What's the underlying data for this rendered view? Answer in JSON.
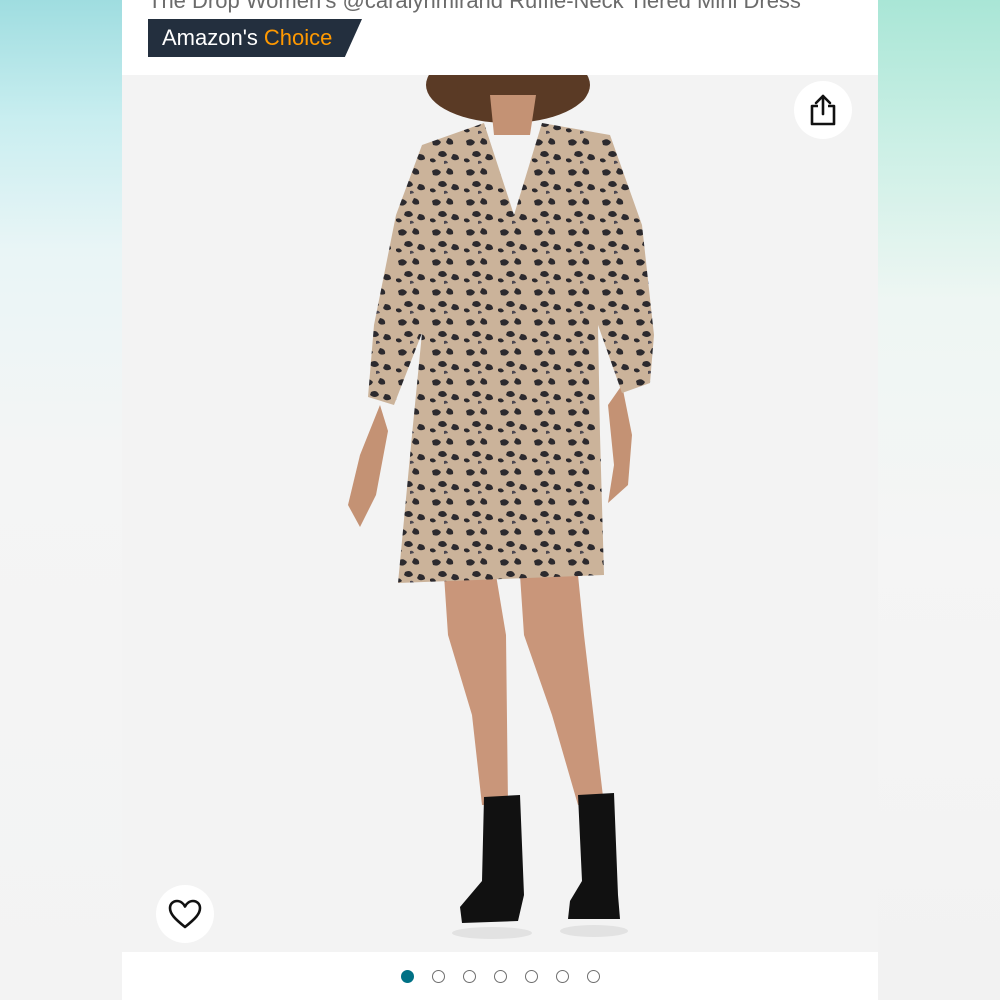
{
  "product": {
    "title": "The Drop Women's @caralynmirand Ruffle-Neck Tiered Mini Dress"
  },
  "badge": {
    "prefix": "Amazon's",
    "accent": "Choice",
    "accent_color": "#f90",
    "background_color": "#232f3e"
  },
  "image": {
    "description_icon": "product-photo",
    "selected_index": 1,
    "total": 7
  },
  "actions": {
    "share_icon": "share-icon",
    "wishlist_icon": "heart-icon"
  },
  "carousel": {
    "active_color": "#007185",
    "dots": [
      {
        "index": 1,
        "active": true
      },
      {
        "index": 2,
        "active": false
      },
      {
        "index": 3,
        "active": false
      },
      {
        "index": 4,
        "active": false
      },
      {
        "index": 5,
        "active": false
      },
      {
        "index": 6,
        "active": false
      },
      {
        "index": 7,
        "active": false
      }
    ]
  }
}
